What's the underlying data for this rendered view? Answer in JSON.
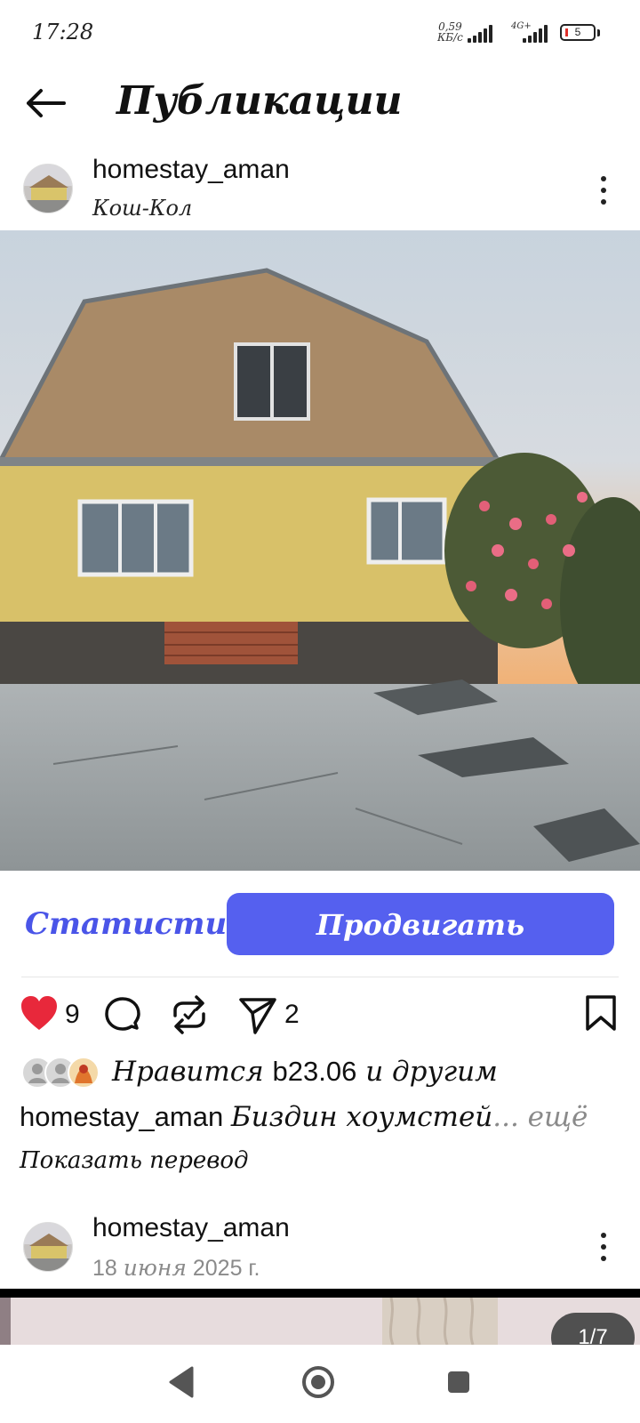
{
  "status_bar": {
    "time": "17:28",
    "net_speed_value": "0,59",
    "net_speed_unit": "КБ/с",
    "network_label": "4G+",
    "battery_level": "5"
  },
  "header": {
    "title": "Публикации",
    "back_icon": "arrow-left-icon"
  },
  "post": {
    "username": "homestay_aman",
    "location": "Кош-Кол",
    "image_description_icon": "photo",
    "stats_label": "Статистика",
    "promote_label": "Продвигать публикацию",
    "likes_count": "9",
    "shares_count": "2",
    "likes_prefix": "Нравится",
    "likes_user": "b23.06",
    "likes_suffix": "и другим",
    "caption_user": "homestay_aman",
    "caption_text": "Биздин хоумстей",
    "caption_more": "... ещё",
    "translate_label": "Показать перевод"
  },
  "next_post": {
    "username": "homestay_aman",
    "date_day": "18",
    "date_month": "июня",
    "date_year": "2025 г.",
    "carousel_counter": "1/7"
  },
  "colors": {
    "accent": "#5560ef",
    "like": "#e8283b"
  }
}
